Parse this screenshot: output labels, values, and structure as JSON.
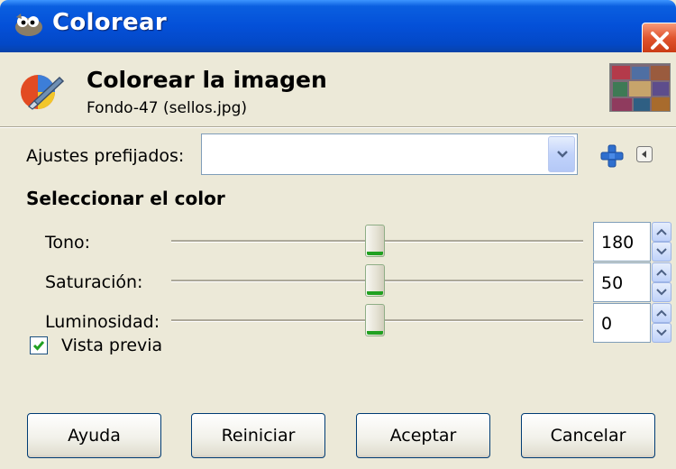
{
  "window": {
    "title": "Colorear"
  },
  "header": {
    "title": "Colorear la imagen",
    "subtitle": "Fondo-47 (sellos.jpg)"
  },
  "presets": {
    "label": "Ajustes prefijados:",
    "value": ""
  },
  "section": {
    "title": "Seleccionar el color"
  },
  "sliders": [
    {
      "label": "Tono:",
      "value": "180"
    },
    {
      "label": "Saturación:",
      "value": "50"
    },
    {
      "label": "Luminosidad:",
      "value": "0"
    }
  ],
  "preview": {
    "label": "Vista previa",
    "checked": true
  },
  "buttons": {
    "help": "Ayuda",
    "reset": "Reiniciar",
    "ok": "Aceptar",
    "cancel": "Cancelar"
  },
  "icons": {
    "title": "gimp-wilber-icon",
    "header": "colorize-icon",
    "add": "plus-icon",
    "menu": "arrow-left-icon",
    "close": "close-icon"
  },
  "colors": {
    "titlebar": "#0450d8",
    "close": "#e0542e",
    "dialog_bg": "#ece9d8",
    "check": "#21a121"
  }
}
